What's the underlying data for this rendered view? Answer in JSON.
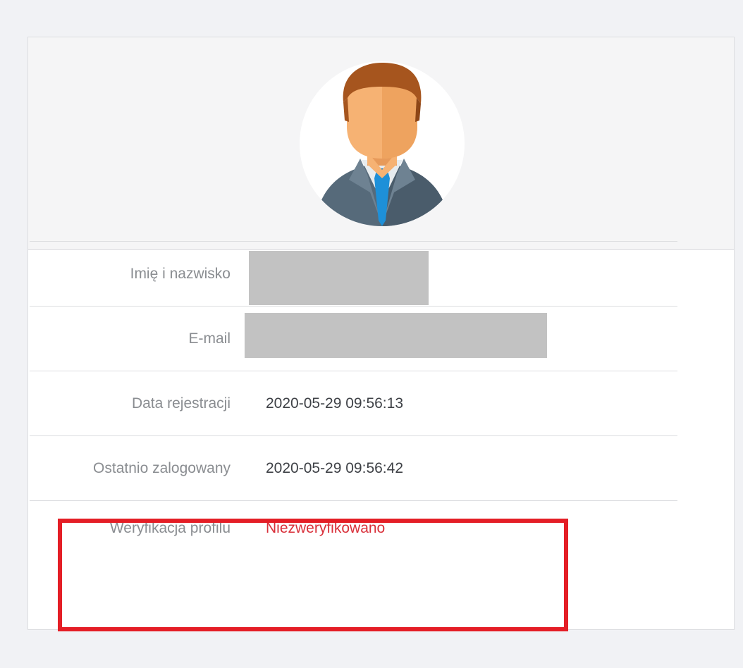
{
  "profile": {
    "avatar_icon": "user-avatar-icon",
    "rows": [
      {
        "label": "Imię i nazwisko",
        "value": ""
      },
      {
        "label": "E-mail",
        "value": ""
      },
      {
        "label": "Data rejestracji",
        "value": "2020-05-29 09:56:13"
      },
      {
        "label": "Ostatnio zalogowany",
        "value": "2020-05-29 09:56:42"
      },
      {
        "label": "Weryfikacja profilu",
        "value": "Niezweryfikowano"
      }
    ]
  },
  "colors": {
    "page_background": "#f1f2f5",
    "label_text": "#8a8d91",
    "value_text": "#3e4146",
    "unverified_text": "#d9303a",
    "highlight_border": "#e41e26",
    "redaction": "#c2c2c2"
  }
}
